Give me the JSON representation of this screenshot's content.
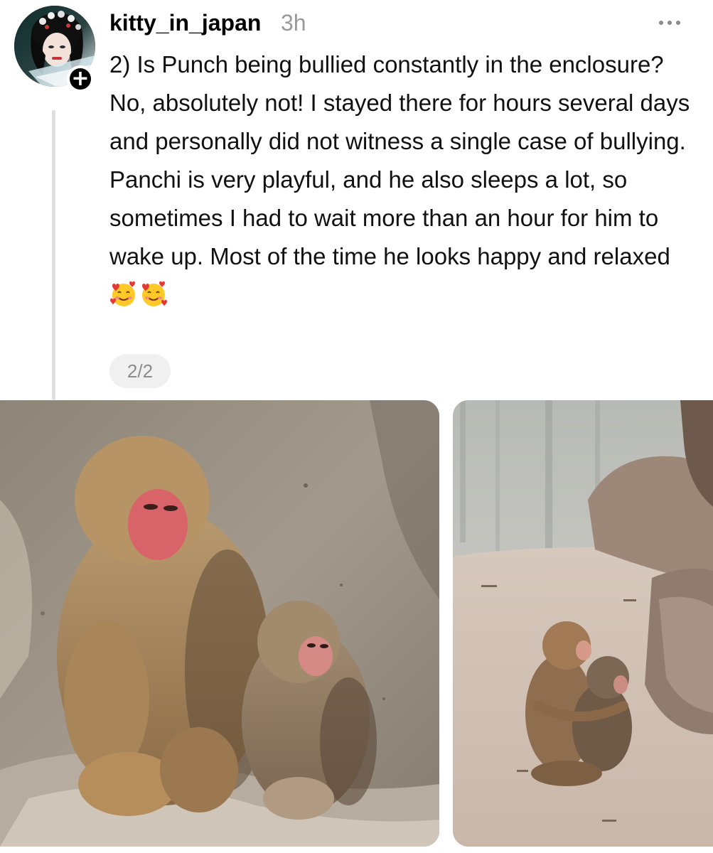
{
  "post": {
    "username": "kitty_in_japan",
    "timestamp": "3h",
    "paragraphs": [
      "2) Is Punch being bullied constantly in the enclosure?",
      "No, absolutely not! I stayed there for hours several days and personally did not witness a single case of bullying. Panchi is very playful, and he also sleeps a lot, so sometimes I had to wait more than an hour for him to wake up. Most of the time he looks happy and relaxed"
    ],
    "emojis": [
      "smiling-face-with-hearts",
      "smiling-face-with-hearts"
    ],
    "pager": "2/2"
  },
  "icons": {
    "more": "more-horizontal-icon",
    "follow": "plus-icon"
  },
  "colors": {
    "text": "#111111",
    "muted": "#9a9a9a",
    "thread_line": "#e0e0e0",
    "pager_bg": "#f0f0f0"
  }
}
